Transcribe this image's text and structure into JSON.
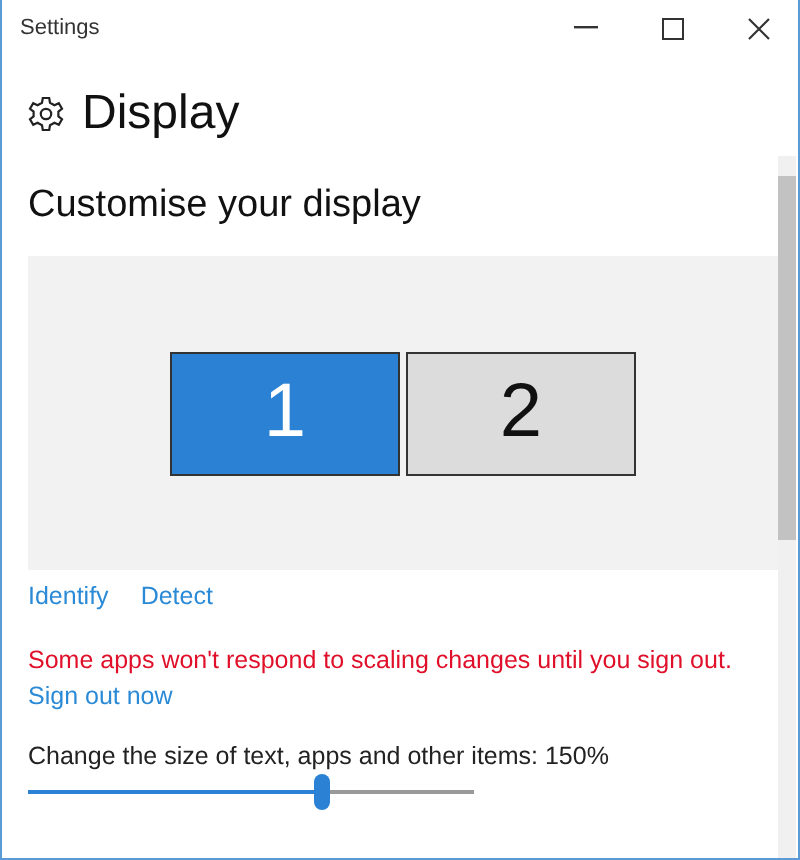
{
  "window": {
    "title": "Settings"
  },
  "page": {
    "title": "Display",
    "heading": "Customise your display"
  },
  "monitors": [
    {
      "label": "1",
      "selected": true
    },
    {
      "label": "2",
      "selected": false
    }
  ],
  "links": [
    "Identify",
    "Detect"
  ],
  "warning": "Some apps won't respond to scaling changes until you sign out.",
  "sign_out_link": "Sign out now",
  "scale": {
    "label": "Change the size of text, apps and other items: 150%",
    "level": 0.66
  }
}
